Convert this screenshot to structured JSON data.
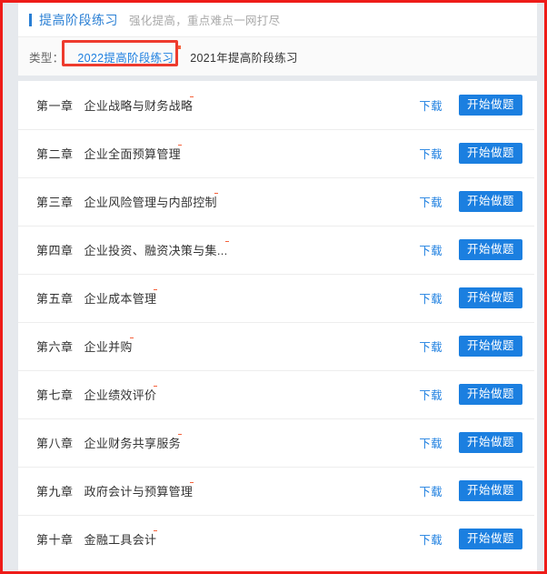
{
  "header": {
    "title": "提高阶段练习",
    "subtitle": "强化提高，重点难点一网打尽"
  },
  "filter": {
    "label": "类型：",
    "tabs": [
      {
        "label": "2022提高阶段练习",
        "active": true,
        "has_new_dot": true
      },
      {
        "label": "2021年提高阶段练习",
        "active": false,
        "has_new_dot": false
      }
    ]
  },
  "colors": {
    "accent_blue": "#1b7fe0",
    "title_blue": "#2a7fd4",
    "new_dot": "#f5623c",
    "annotation_red": "#ee3b2e",
    "page_bg": "#e6e9ed"
  },
  "actions": {
    "download_label": "下载",
    "start_label": "开始做题"
  },
  "list": {
    "rows": [
      {
        "num": "第一章",
        "name": "企业战略与财务战略",
        "has_new_dot": true
      },
      {
        "num": "第二章",
        "name": "企业全面预算管理",
        "has_new_dot": true
      },
      {
        "num": "第三章",
        "name": "企业风险管理与内部控制",
        "has_new_dot": true
      },
      {
        "num": "第四章",
        "name": "企业投资、融资决策与集...",
        "has_new_dot": true
      },
      {
        "num": "第五章",
        "name": "企业成本管理",
        "has_new_dot": true
      },
      {
        "num": "第六章",
        "name": "企业并购",
        "has_new_dot": true
      },
      {
        "num": "第七章",
        "name": "企业绩效评价",
        "has_new_dot": true
      },
      {
        "num": "第八章",
        "name": "企业财务共享服务",
        "has_new_dot": true
      },
      {
        "num": "第九章",
        "name": "政府会计与预算管理",
        "has_new_dot": true
      },
      {
        "num": "第十章",
        "name": "金融工具会计",
        "has_new_dot": true
      }
    ]
  }
}
